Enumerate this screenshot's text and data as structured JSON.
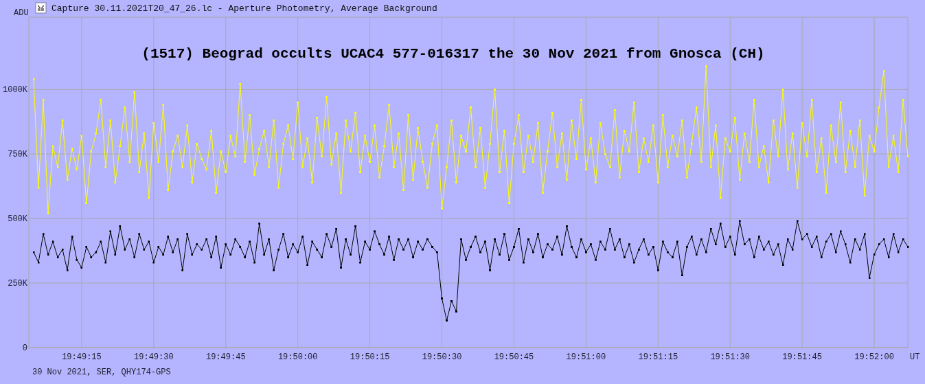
{
  "window": {
    "title": "Capture 30.11.2021T20_47_26.lc - Aperture Photometry, Average Background"
  },
  "chart": {
    "chart_data": {
      "type": "line",
      "title": "(1517) Beograd occults UCAC4 577-016317 the 30 Nov 2021 from Gnosca (CH)",
      "xlabel": "UT",
      "ylabel": "ADU",
      "ylim": [
        0,
        1280
      ],
      "grid": true,
      "categories": [
        null,
        null,
        null,
        null,
        null,
        null,
        null,
        null,
        null,
        null,
        "19:49:15",
        null,
        null,
        null,
        null,
        null,
        null,
        null,
        null,
        null,
        null,
        null,
        null,
        null,
        null,
        "19:49:30",
        null,
        null,
        null,
        null,
        null,
        null,
        null,
        null,
        null,
        null,
        null,
        null,
        null,
        null,
        "19:49:45",
        null,
        null,
        null,
        null,
        null,
        null,
        null,
        null,
        null,
        null,
        null,
        null,
        null,
        null,
        "19:50:00",
        null,
        null,
        null,
        null,
        null,
        null,
        null,
        null,
        null,
        null,
        null,
        null,
        null,
        null,
        "19:50:15",
        null,
        null,
        null,
        null,
        null,
        null,
        null,
        null,
        null,
        null,
        null,
        null,
        null,
        null,
        "19:50:30",
        null,
        null,
        null,
        null,
        null,
        null,
        null,
        null,
        null,
        null,
        null,
        null,
        null,
        null,
        "19:50:45",
        null,
        null,
        null,
        null,
        null,
        null,
        null,
        null,
        null,
        null,
        null,
        null,
        null,
        null,
        "19:51:00",
        null,
        null,
        null,
        null,
        null,
        null,
        null,
        null,
        null,
        null,
        null,
        null,
        null,
        null,
        "19:51:15",
        null,
        null,
        null,
        null,
        null,
        null,
        null,
        null,
        null,
        null,
        null,
        null,
        null,
        null,
        "19:51:30",
        null,
        null,
        null,
        null,
        null,
        null,
        null,
        null,
        null,
        null,
        null,
        null,
        null,
        null,
        "19:51:45",
        null,
        null,
        null,
        null,
        null,
        null,
        null,
        null,
        null,
        null,
        null,
        null,
        null,
        null,
        "19:52:00",
        null,
        null,
        null,
        null,
        null,
        null,
        null
      ],
      "yticks": [
        {
          "value": 0,
          "label": "0"
        },
        {
          "value": 250,
          "label": "250K"
        },
        {
          "value": 500,
          "label": "500K"
        },
        {
          "value": 750,
          "label": "750K"
        },
        {
          "value": 1000,
          "label": "1000K"
        }
      ],
      "series": [
        {
          "color": "#ffff00",
          "values": [
            1040,
            620,
            960,
            520,
            780,
            700,
            880,
            650,
            770,
            690,
            820,
            560,
            760,
            830,
            960,
            700,
            880,
            640,
            780,
            930,
            720,
            990,
            680,
            830,
            580,
            870,
            720,
            940,
            610,
            760,
            820,
            700,
            860,
            640,
            790,
            730,
            690,
            840,
            600,
            760,
            680,
            820,
            740,
            1020,
            720,
            900,
            670,
            770,
            840,
            700,
            880,
            620,
            790,
            860,
            730,
            950,
            700,
            810,
            640,
            890,
            740,
            970,
            710,
            830,
            600,
            880,
            760,
            910,
            680,
            820,
            720,
            860,
            660,
            780,
            940,
            700,
            830,
            610,
            900,
            650,
            850,
            720,
            620,
            790,
            860,
            540,
            700,
            880,
            640,
            820,
            760,
            930,
            700,
            850,
            620,
            790,
            1000,
            680,
            840,
            560,
            790,
            900,
            680,
            820,
            720,
            870,
            600,
            760,
            910,
            700,
            830,
            650,
            880,
            730,
            960,
            690,
            810,
            640,
            870,
            750,
            700,
            920,
            660,
            840,
            760,
            950,
            680,
            810,
            720,
            860,
            640,
            900,
            700,
            820,
            740,
            880,
            660,
            790,
            930,
            720,
            1090,
            700,
            860,
            580,
            810,
            760,
            890,
            650,
            830,
            720,
            960,
            700,
            780,
            640,
            880,
            740,
            1000,
            690,
            830,
            620,
            870,
            740,
            960,
            680,
            810,
            600,
            860,
            720,
            950,
            680,
            840,
            700,
            880,
            590,
            820,
            760,
            930,
            1070,
            700,
            820,
            680,
            960,
            740
          ]
        },
        {
          "color": "#000000",
          "values": [
            370,
            330,
            440,
            360,
            410,
            350,
            380,
            300,
            430,
            340,
            310,
            390,
            350,
            370,
            410,
            330,
            450,
            360,
            470,
            380,
            420,
            350,
            440,
            380,
            410,
            330,
            390,
            360,
            430,
            370,
            420,
            300,
            440,
            360,
            400,
            380,
            420,
            350,
            430,
            310,
            400,
            360,
            420,
            390,
            350,
            410,
            330,
            480,
            360,
            420,
            300,
            380,
            440,
            350,
            400,
            370,
            430,
            320,
            410,
            380,
            350,
            440,
            390,
            460,
            310,
            420,
            360,
            470,
            330,
            410,
            380,
            450,
            400,
            360,
            430,
            340,
            420,
            380,
            420,
            350,
            410,
            380,
            420,
            390,
            370,
            190,
            105,
            180,
            140,
            420,
            340,
            390,
            430,
            370,
            410,
            300,
            420,
            360,
            440,
            340,
            390,
            460,
            330,
            420,
            370,
            440,
            350,
            400,
            380,
            430,
            360,
            470,
            390,
            350,
            420,
            370,
            400,
            340,
            410,
            380,
            460,
            380,
            420,
            350,
            400,
            330,
            380,
            420,
            360,
            390,
            300,
            410,
            370,
            350,
            410,
            280,
            390,
            430,
            360,
            420,
            370,
            460,
            400,
            480,
            390,
            430,
            360,
            490,
            400,
            420,
            350,
            430,
            380,
            410,
            360,
            400,
            320,
            420,
            380,
            490,
            420,
            440,
            390,
            430,
            350,
            410,
            440,
            370,
            450,
            400,
            330,
            420,
            380,
            440,
            270,
            360,
            400,
            420,
            350,
            440,
            370,
            420,
            390
          ]
        }
      ]
    }
  },
  "footer": {
    "text": "30 Nov 2021, SER, QHY174-GPS"
  }
}
